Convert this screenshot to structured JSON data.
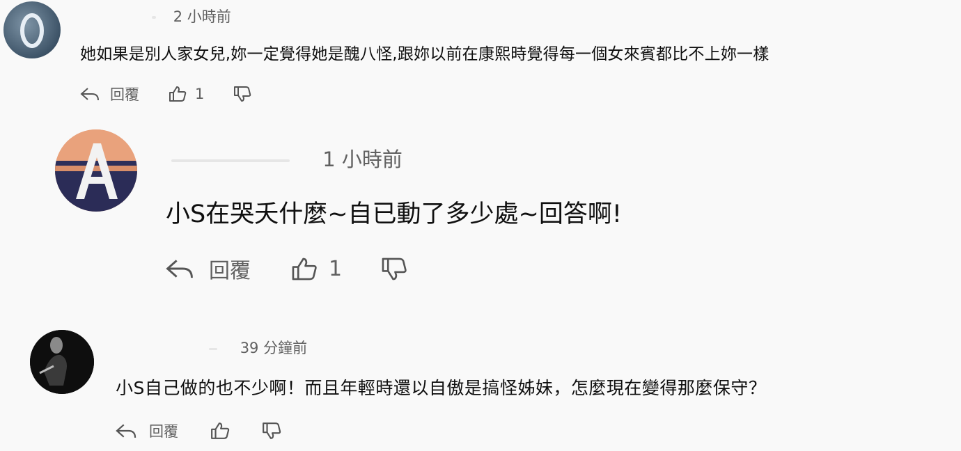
{
  "comments": [
    {
      "time": "2 小時前",
      "text": "她如果是別人家女兒,妳一定覺得她是醜八怪,跟妳以前在康熙時覺得每一個女來賓都比不上妳一樣",
      "reply_label": "回覆",
      "like_count": "1"
    },
    {
      "time": "1 小時前",
      "text": "小S在哭夭什麼~自已動了多少處~回答啊!",
      "reply_label": "回覆",
      "like_count": "1"
    },
    {
      "time": "39 分鐘前",
      "text": "小S自己做的也不少啊！而且年輕時還以自傲是搞怪姊妹，怎麼現在變得那麼保守？",
      "reply_label": "回覆",
      "like_count": ""
    }
  ],
  "icons": {
    "reply": "reply-arrow-icon",
    "like": "thumbs-up-icon",
    "dislike": "thumbs-down-icon"
  },
  "colors": {
    "background": "#f9f9f9",
    "text": "#0f0f0f",
    "meta": "#606060"
  }
}
